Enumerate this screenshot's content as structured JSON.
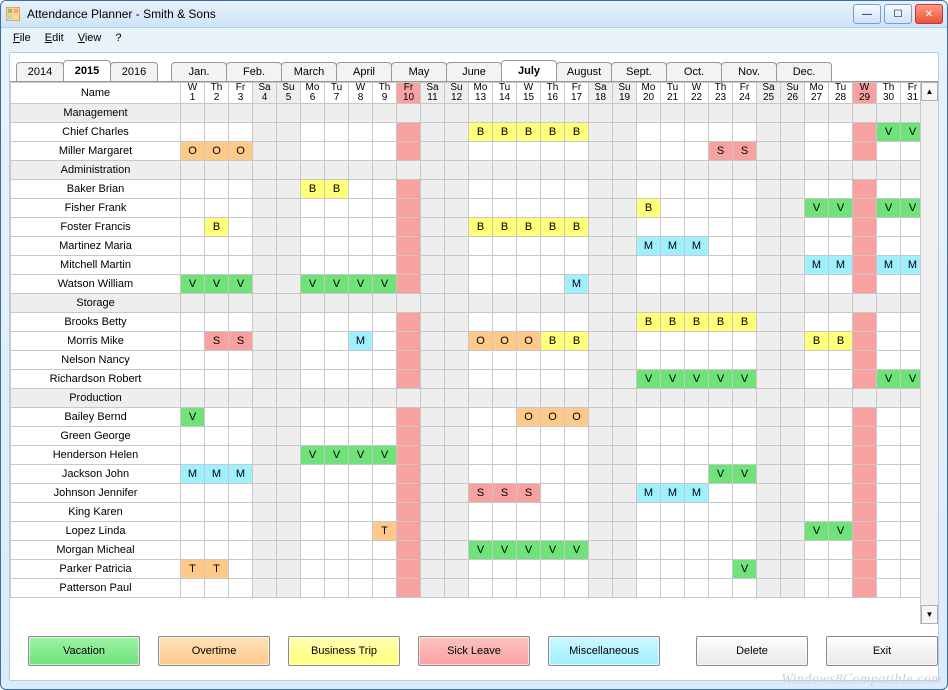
{
  "window": {
    "title": "Attendance Planner - Smith & Sons"
  },
  "menus": {
    "file": "File",
    "edit": "Edit",
    "view": "View",
    "help": "?"
  },
  "years": [
    {
      "label": "2014",
      "selected": false
    },
    {
      "label": "2015",
      "selected": true
    },
    {
      "label": "2016",
      "selected": false
    }
  ],
  "months": [
    {
      "label": "Jan."
    },
    {
      "label": "Feb."
    },
    {
      "label": "March"
    },
    {
      "label": "April"
    },
    {
      "label": "May"
    },
    {
      "label": "June"
    },
    {
      "label": "July",
      "selected": true
    },
    {
      "label": "August"
    },
    {
      "label": "Sept."
    },
    {
      "label": "Oct."
    },
    {
      "label": "Nov."
    },
    {
      "label": "Dec."
    }
  ],
  "name_header": "Name",
  "days": [
    {
      "dow": "W",
      "num": "1"
    },
    {
      "dow": "Th",
      "num": "2"
    },
    {
      "dow": "Fr",
      "num": "3"
    },
    {
      "dow": "Sa",
      "num": "4"
    },
    {
      "dow": "Su",
      "num": "5"
    },
    {
      "dow": "Mo",
      "num": "6"
    },
    {
      "dow": "Tu",
      "num": "7"
    },
    {
      "dow": "W",
      "num": "8"
    },
    {
      "dow": "Th",
      "num": "9"
    },
    {
      "dow": "Fr",
      "num": "10"
    },
    {
      "dow": "Sa",
      "num": "11"
    },
    {
      "dow": "Su",
      "num": "12"
    },
    {
      "dow": "Mo",
      "num": "13"
    },
    {
      "dow": "Tu",
      "num": "14"
    },
    {
      "dow": "W",
      "num": "15"
    },
    {
      "dow": "Th",
      "num": "16"
    },
    {
      "dow": "Fr",
      "num": "17"
    },
    {
      "dow": "Sa",
      "num": "18"
    },
    {
      "dow": "Su",
      "num": "19"
    },
    {
      "dow": "Mo",
      "num": "20"
    },
    {
      "dow": "Tu",
      "num": "21"
    },
    {
      "dow": "W",
      "num": "22"
    },
    {
      "dow": "Th",
      "num": "23"
    },
    {
      "dow": "Fr",
      "num": "24"
    },
    {
      "dow": "Sa",
      "num": "25"
    },
    {
      "dow": "Su",
      "num": "26"
    },
    {
      "dow": "Mo",
      "num": "27"
    },
    {
      "dow": "Tu",
      "num": "28"
    },
    {
      "dow": "W",
      "num": "29"
    },
    {
      "dow": "Th",
      "num": "30"
    },
    {
      "dow": "Fr",
      "num": "31"
    }
  ],
  "weekend_days": [
    4,
    5,
    11,
    12,
    18,
    19,
    25,
    26
  ],
  "holiday_days": [
    10,
    29
  ],
  "rows": [
    {
      "name": "Management",
      "group": true
    },
    {
      "name": "Chief Charles",
      "cells": {
        "13": "B",
        "14": "B",
        "15": "B",
        "16": "B",
        "17": "B",
        "30": "V",
        "31": "V"
      }
    },
    {
      "name": "Miller Margaret",
      "cells": {
        "1": "O",
        "2": "O",
        "3": "O",
        "23": "S",
        "24": "S"
      }
    },
    {
      "name": "Administration",
      "group": true
    },
    {
      "name": "Baker Brian",
      "cells": {
        "6": "B",
        "7": "B"
      }
    },
    {
      "name": "Fisher Frank",
      "cells": {
        "20": "B",
        "27": "V",
        "28": "V",
        "30": "V",
        "31": "V"
      }
    },
    {
      "name": "Foster Francis",
      "cells": {
        "2": "B",
        "13": "B",
        "14": "B",
        "15": "B",
        "16": "B",
        "17": "B"
      }
    },
    {
      "name": "Martinez Maria",
      "cells": {
        "20": "M",
        "21": "M",
        "22": "M"
      }
    },
    {
      "name": "Mitchell Martin",
      "cells": {
        "27": "M",
        "28": "M",
        "30": "M",
        "31": "M"
      }
    },
    {
      "name": "Watson William",
      "cells": {
        "1": "V",
        "2": "V",
        "3": "V",
        "6": "V",
        "7": "V",
        "8": "V",
        "9": "V",
        "17": "M"
      }
    },
    {
      "name": "Storage",
      "group": true
    },
    {
      "name": "Brooks Betty",
      "cells": {
        "20": "B",
        "21": "B",
        "22": "B",
        "23": "B",
        "24": "B"
      }
    },
    {
      "name": "Morris Mike",
      "cells": {
        "2": "S",
        "3": "S",
        "8": "M",
        "13": "O",
        "14": "O",
        "15": "O",
        "16": "B",
        "17": "B",
        "27": "B",
        "28": "B"
      }
    },
    {
      "name": "Nelson Nancy",
      "cells": {}
    },
    {
      "name": "Richardson Robert",
      "cells": {
        "20": "V",
        "21": "V",
        "22": "V",
        "23": "V",
        "24": "V",
        "30": "V",
        "31": "V"
      }
    },
    {
      "name": "Production",
      "group": true
    },
    {
      "name": "Bailey Bernd",
      "cells": {
        "1": "V",
        "15": "O",
        "16": "O",
        "17": "O"
      }
    },
    {
      "name": "Green George",
      "cells": {}
    },
    {
      "name": "Henderson Helen",
      "cells": {
        "6": "V",
        "7": "V",
        "8": "V",
        "9": "V"
      }
    },
    {
      "name": "Jackson John",
      "cells": {
        "1": "M",
        "2": "M",
        "3": "M",
        "23": "V",
        "24": "V"
      }
    },
    {
      "name": "Johnson Jennifer",
      "cells": {
        "13": "S",
        "14": "S",
        "15": "S",
        "20": "M",
        "21": "M",
        "22": "M"
      }
    },
    {
      "name": "King Karen",
      "cells": {}
    },
    {
      "name": "Lopez Linda",
      "cells": {
        "9": "T",
        "27": "V",
        "28": "V"
      }
    },
    {
      "name": "Morgan Micheal",
      "cells": {
        "13": "V",
        "14": "V",
        "15": "V",
        "16": "V",
        "17": "V"
      }
    },
    {
      "name": "Parker Patricia",
      "cells": {
        "1": "T",
        "2": "T",
        "24": "V"
      }
    },
    {
      "name": "Patterson Paul",
      "cells": {}
    }
  ],
  "legend": {
    "vacation": "Vacation",
    "overtime": "Overtime",
    "business": "Business Trip",
    "sick": "Sick Leave",
    "misc": "Miscellaneous",
    "delete": "Delete",
    "exit": "Exit"
  },
  "watermark": "Windows8Compatible.com"
}
